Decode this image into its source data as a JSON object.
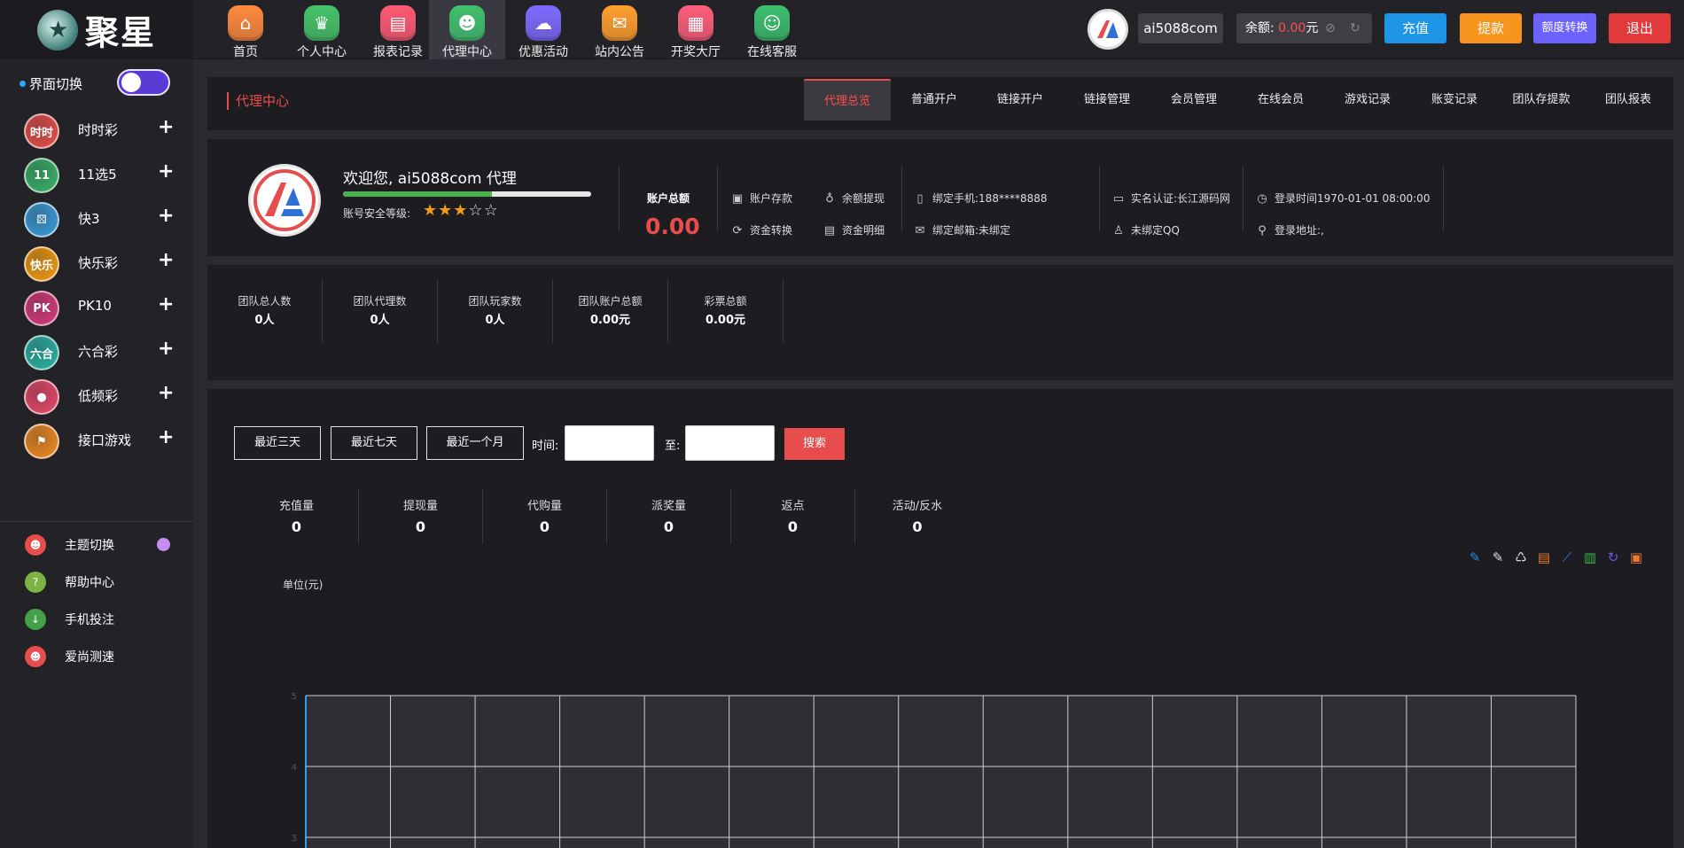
{
  "brand": {
    "name": "聚星"
  },
  "nav": [
    {
      "label": "首页",
      "icon": "home-icon",
      "color": "#ff8a3d",
      "glyph": "⌂"
    },
    {
      "label": "个人中心",
      "icon": "crown-icon",
      "color": "#46c46a",
      "glyph": "♛"
    },
    {
      "label": "报表记录",
      "icon": "report-icon",
      "color": "#ff5a74",
      "glyph": "▤"
    },
    {
      "label": "代理中心",
      "icon": "agent-icon",
      "color": "#3fbf6d",
      "glyph": "☻"
    },
    {
      "label": "优惠活动",
      "icon": "gift-icon",
      "color": "#7d6bff",
      "glyph": "☁"
    },
    {
      "label": "站内公告",
      "icon": "mail-icon",
      "color": "#ff9f2e",
      "glyph": "✉"
    },
    {
      "label": "开奖大厅",
      "icon": "grid-icon",
      "color": "#ff5e7b",
      "glyph": "▦"
    },
    {
      "label": "在线客服",
      "icon": "support-icon",
      "color": "#3cc06e",
      "glyph": "☺"
    }
  ],
  "header": {
    "username": "ai5088com",
    "balance_label": "余额:",
    "balance_value": "0.00",
    "balance_unit": "元",
    "buttons": {
      "recharge": "充值",
      "withdraw": "提款",
      "transfer": "额度转换",
      "logout": "退出"
    },
    "button_colors": {
      "recharge": "#1e96e8",
      "withdraw": "#f7941d",
      "transfer": "#6c63ff",
      "logout": "#e23a3a"
    }
  },
  "sidebar": {
    "theme_label": "界面切换",
    "lotteries": [
      {
        "label": "时时彩",
        "icon": "shishicai-icon",
        "badge": "时时",
        "color": "#e8504a"
      },
      {
        "label": "11选5",
        "icon": "11x5-icon",
        "badge": "11",
        "color": "#3ab36a"
      },
      {
        "label": "快3",
        "icon": "k3-icon",
        "badge": "⚄",
        "color": "#3a9ddb"
      },
      {
        "label": "快乐彩",
        "icon": "kuailecai-icon",
        "badge": "快乐",
        "color": "#f39c12"
      },
      {
        "label": "PK10",
        "icon": "pk10-icon",
        "badge": "PK",
        "color": "#d63b7e"
      },
      {
        "label": "六合彩",
        "icon": "liuhecai-icon",
        "badge": "六合",
        "color": "#2bb3a6"
      },
      {
        "label": "低频彩",
        "icon": "dipincai-icon",
        "badge": "●",
        "color": "#e84a6a"
      },
      {
        "label": "接口游戏",
        "icon": "api-game-icon",
        "badge": "⚑",
        "color": "#f28c22"
      }
    ],
    "utilities": [
      {
        "label": "主题切换",
        "icon": "theme-icon",
        "color": "#e84d4d",
        "glyph": "☻"
      },
      {
        "label": "帮助中心",
        "icon": "help-icon",
        "color": "#7cb342",
        "glyph": "?"
      },
      {
        "label": "手机投注",
        "icon": "mobile-icon",
        "color": "#43a047",
        "glyph": "↓"
      },
      {
        "label": "爱尚测速",
        "icon": "speed-icon",
        "color": "#e84d4d",
        "glyph": "☻"
      }
    ]
  },
  "tabs": {
    "crumb": "代理中心",
    "items": [
      "代理总览",
      "普通开户",
      "链接开户",
      "链接管理",
      "会员管理",
      "在线会员",
      "游戏记录",
      "账变记录",
      "团队存提款",
      "团队报表"
    ]
  },
  "profile": {
    "welcome": "欢迎您,   ai5088com 代理",
    "security_label": "账号安全等级:",
    "security_level": 3,
    "security_max": 5,
    "security_progress": 0.6,
    "account_total_label": "账户总额",
    "account_total": "0.00",
    "actions": {
      "deposit": "账户存款",
      "withdraw": "余额提现",
      "fund_transfer": "资金转换",
      "fund_detail": "资金明细"
    },
    "phone": "绑定手机:188****8888",
    "email": "绑定邮箱:未绑定",
    "realname": "实名认证:长江源码网",
    "qq": "未绑定QQ",
    "login_time": "登录时间1970-01-01 08:00:00",
    "login_addr": "登录地址:,"
  },
  "team": [
    {
      "label": "团队总人数",
      "value": "0人"
    },
    {
      "label": "团队代理数",
      "value": "0人"
    },
    {
      "label": "团队玩家数",
      "value": "0人"
    },
    {
      "label": "团队账户总额",
      "value": "0.00元"
    },
    {
      "label": "彩票总额",
      "value": "0.00元"
    }
  ],
  "filters": {
    "quick": [
      "最近三天",
      "最近七天",
      "最近一个月"
    ],
    "time_label": "时间:",
    "to_label": "至:",
    "search": "搜索"
  },
  "report_stats": [
    {
      "label": "充值量",
      "value": "0"
    },
    {
      "label": "提现量",
      "value": "0"
    },
    {
      "label": "代购量",
      "value": "0"
    },
    {
      "label": "派奖量",
      "value": "0"
    },
    {
      "label": "返点",
      "value": "0"
    },
    {
      "label": "活动/反水",
      "value": "0"
    }
  ],
  "chart": {
    "unit_label": "单位(元)",
    "tools": [
      {
        "icon": "zoom-icon",
        "glyph": "✎",
        "color": "#2a8ae6"
      },
      {
        "icon": "zoom-reset-icon",
        "glyph": "✎",
        "color": "#ddd"
      },
      {
        "icon": "restore-icon",
        "glyph": "♺",
        "color": "#ddd"
      },
      {
        "icon": "data-view-icon",
        "glyph": "▤",
        "color": "#e87b2d"
      },
      {
        "icon": "line-chart-icon",
        "glyph": "⟋",
        "color": "#2a8ae6"
      },
      {
        "icon": "bar-chart-icon",
        "glyph": "▥",
        "color": "#3cb34a"
      },
      {
        "icon": "refresh-icon",
        "glyph": "↻",
        "color": "#6a5be6"
      },
      {
        "icon": "save-icon",
        "glyph": "▣",
        "color": "#e87b2d"
      }
    ]
  },
  "chart_data": {
    "type": "line",
    "ylabel": "单位(元)",
    "y_ticks": [
      5,
      4,
      3
    ],
    "ylim": [
      0,
      5
    ],
    "series": [],
    "grid": true
  }
}
